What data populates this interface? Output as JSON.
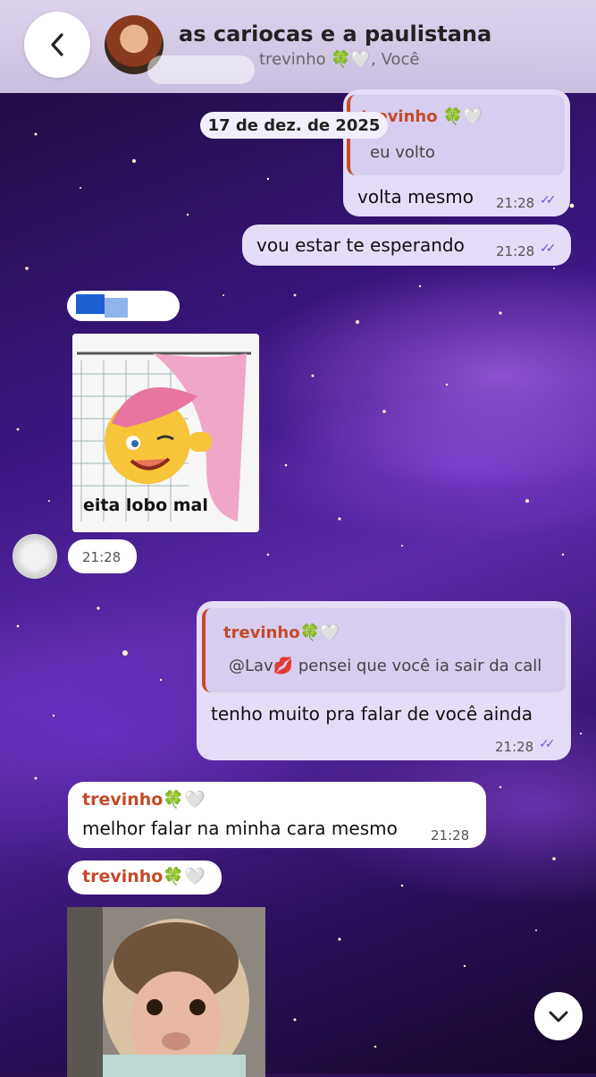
{
  "header": {
    "title": "as cariocas e a paulistana",
    "members": "trevinho 🍀🤍, Você"
  },
  "date_chip": "17 de dez. de 2025",
  "messages": {
    "m1": {
      "quote_name": "trevinho 🍀🤍",
      "quote_text": "eu volto",
      "text": "volta mesmo",
      "time": "21:28"
    },
    "m2": {
      "text": "vou estar te esperando",
      "time": "21:28"
    },
    "m3": {
      "sticker_caption": "eita lobo mal",
      "time": "21:28"
    },
    "m4": {
      "quote_name": "trevinho🍀🤍",
      "quote_text": "@Lav💋 pensei que você ia sair da call",
      "text": "tenho muito pra falar de você ainda",
      "time": "21:28"
    },
    "m5": {
      "sender": "trevinho🍀🤍",
      "text": "melhor falar na minha cara mesmo",
      "time": "21:28"
    },
    "m6": {
      "sender": "trevinho🍀🤍"
    }
  },
  "colors": {
    "outgoing_bubble": "#e5dcf7",
    "incoming_bubble": "#ffffff",
    "sender_name": "#c44a2a",
    "read_checks": "#6b5bd6"
  },
  "icons": {
    "back": "chevron-left-icon",
    "scroll_down": "chevron-down-icon",
    "read": "double-check-icon"
  }
}
